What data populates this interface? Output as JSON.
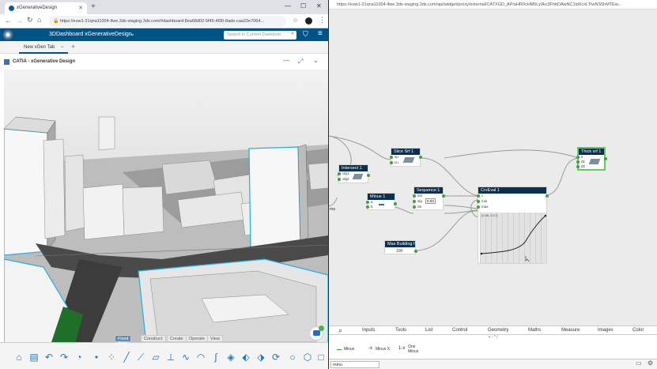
{
  "browser": {
    "tab_title": "xGenerativeDesign",
    "new_tab_symbol": "+",
    "url": "https://euw1-21qna11004-ifwe.3dx-staging.3ds.com/#dashboard:8ea68d02-5f45-4f30-8ade-caa23e7064...",
    "window_controls": [
      "—",
      "☐",
      "✕"
    ]
  },
  "dashboard": {
    "title": "3DDashboard xGenerativeDesign",
    "search_placeholder": "Search in Current Dashboar",
    "tab_label": "New xGen Tab",
    "widget_title": "CATIA - xGenerative Design"
  },
  "toolbar": {
    "tabs": [
      "Fixed Area",
      "Construct",
      "Create",
      "Operate",
      "View"
    ],
    "active_tab": "Fixed Area",
    "icons": [
      "home-icon",
      "document-icon",
      "undo-icon",
      "redo-icon",
      "rss-icon",
      "point-icon",
      "grid-points-icon",
      "line-icon",
      "polyline-icon",
      "plane-icon",
      "axis-icon",
      "curve-icon",
      "arc-icon",
      "spline-icon",
      "surface-icon",
      "sweep-icon",
      "loft-icon",
      "revolve-icon",
      "blend-icon",
      "offset-icon",
      "circle-icon",
      "hexagon-icon",
      "square-icon"
    ]
  },
  "widget_url": "https://euw1-21qna11004-ifwe.3dx-staging.3ds.com/api/widget/proxy/external/CATXGD_AP/aHR0cHM6Ly9kc3FhbDAwNC1ldXcxLTIwNS5hMTEw...",
  "nodes": {
    "slice": {
      "title": "Slice Srf 1",
      "ports": [
        "su",
        "cu"
      ]
    },
    "intersect": {
      "title": "Intersect 1",
      "ports": [
        "obj1",
        "obj2"
      ]
    },
    "minus": {
      "title": "Minus 1",
      "ports": [
        "a",
        "b"
      ]
    },
    "sequence": {
      "title": "Sequence 1",
      "ports": [
        "init",
        "stp",
        "nb"
      ],
      "stp_value": "0.03"
    },
    "crveval": {
      "title": "CrvEval 1",
      "ports": [
        "c",
        "min",
        "max"
      ],
      "graph_label": "(0.48, 0.17)"
    },
    "maxbuilding": {
      "title": "Max Building h",
      "value": "100"
    },
    "thick": {
      "title": "Thick srf 1",
      "ports": [
        "s",
        "d1",
        "d2"
      ]
    },
    "edge_label": "ma"
  },
  "bottom_tabs": [
    "Inputs",
    "Tools",
    "List",
    "Control",
    "Geometry",
    "Maths",
    "Measure",
    "Images",
    "Color"
  ],
  "sub_row": "+ - * /",
  "list_items": [
    {
      "icon": "minus-icon",
      "label": "Minus"
    },
    {
      "icon": "minus-x-icon",
      "label": "Minus X"
    },
    {
      "icon": "one-minus-icon",
      "label": "One Minus"
    }
  ],
  "search_value": "minu",
  "colors": {
    "accent": "#005386",
    "node_header": "#0b2f4e",
    "port": "#3aa33a",
    "highlight": "#5fcf5f",
    "building_edge": "#1eb0e6"
  }
}
